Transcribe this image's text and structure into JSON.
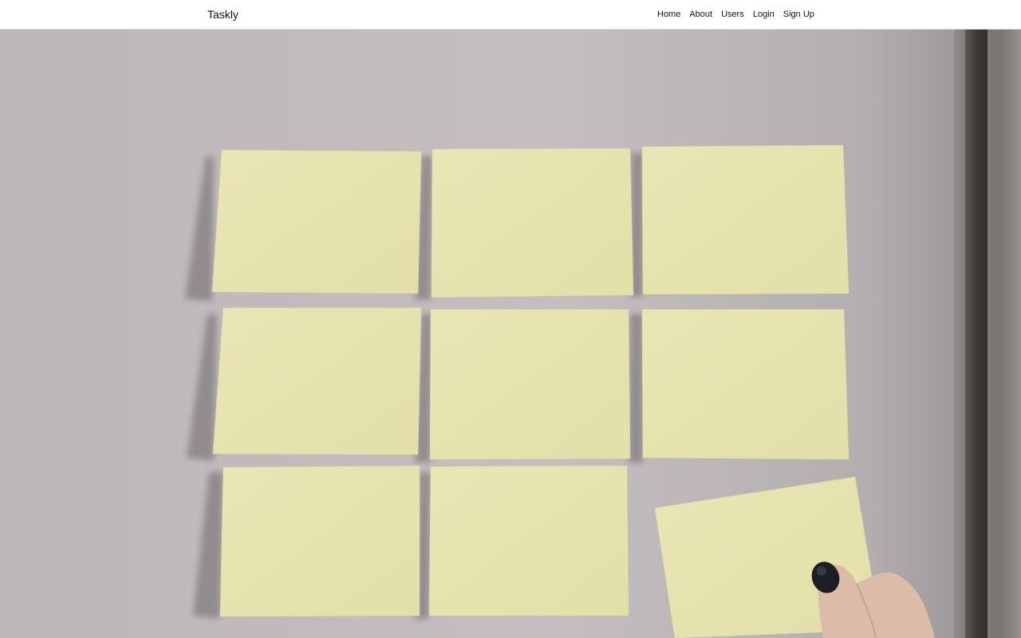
{
  "nav": {
    "brand": "Taskly",
    "links": [
      {
        "label": "Home"
      },
      {
        "label": "About"
      },
      {
        "label": "Users"
      },
      {
        "label": "Login"
      },
      {
        "label": "Sign Up"
      }
    ]
  },
  "hero": {
    "image": "sticky-notes-on-wall-photo",
    "note_count": 9,
    "colors": {
      "wall": "#c2bcbf",
      "note": "#e6e2ad",
      "door_frame": "#2d2b29"
    }
  }
}
